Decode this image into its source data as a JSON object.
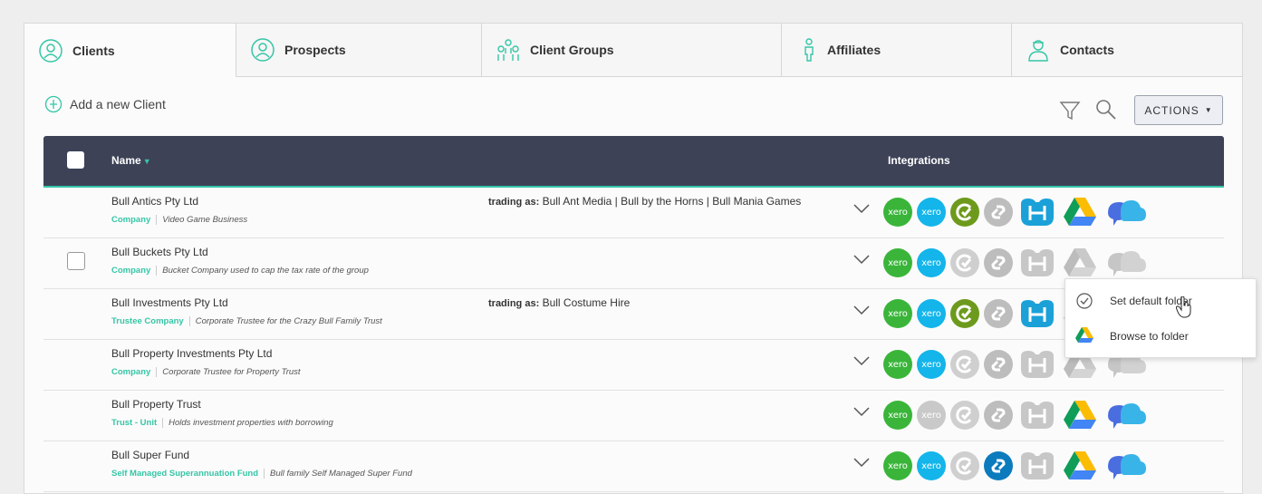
{
  "tabs": [
    {
      "label": "Clients",
      "icon": "user-circle-icon",
      "active": true
    },
    {
      "label": "Prospects",
      "icon": "user-circle-icon",
      "active": false
    },
    {
      "label": "Client Groups",
      "icon": "group-icon",
      "active": false
    },
    {
      "label": "Affiliates",
      "icon": "person-icon",
      "active": false
    },
    {
      "label": "Contacts",
      "icon": "contact-card-icon",
      "active": false
    }
  ],
  "toolbar": {
    "add_label": "Add a new Client",
    "actions_label": "ACTIONS"
  },
  "table": {
    "col_name": "Name",
    "col_integrations": "Integrations",
    "trading_prefix": "trading as:",
    "rows": [
      {
        "name": "Bull Antics Pty Ltd",
        "type": "Company",
        "desc": "Video Game Business",
        "trading": "Bull Ant Media | Bull by the Horns | Bull Mania Games"
      },
      {
        "name": "Bull Buckets Pty Ltd",
        "type": "Company",
        "desc": "Bucket Company used to cap the tax rate of the group",
        "trading": ""
      },
      {
        "name": "Bull Investments Pty Ltd",
        "type": "Trustee Company",
        "desc": "Corporate Trustee for the Crazy Bull Family Trust",
        "trading": "Bull Costume Hire"
      },
      {
        "name": "Bull Property Investments Pty Ltd",
        "type": "Company",
        "desc": "Corporate Trustee for Property Trust",
        "trading": ""
      },
      {
        "name": "Bull Property Trust",
        "type": "Trust - Unit",
        "desc": "Holds investment properties with borrowing",
        "trading": ""
      },
      {
        "name": "Bull Super Fund",
        "type": "Self Managed Superannuation Fund",
        "desc": "Bull family Self Managed Super Fund",
        "trading": ""
      }
    ]
  },
  "integrations_labels": {
    "xero": "xero"
  },
  "menu": {
    "set_default": "Set default folder",
    "browse": "Browse to folder"
  },
  "colors": {
    "accent": "#35c6a6",
    "header": "#3d4257",
    "xero_green": "#3ab53a",
    "xero_blue": "#13b5ea"
  }
}
